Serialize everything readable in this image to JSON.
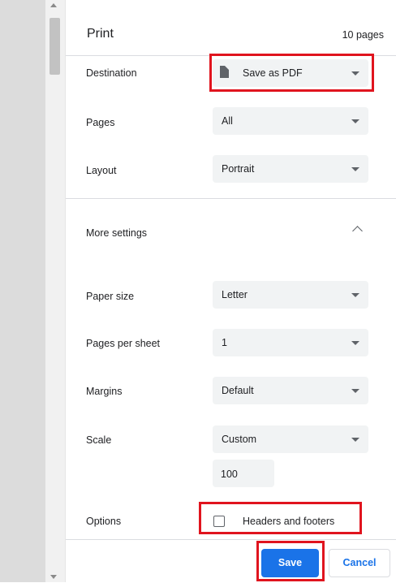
{
  "header": {
    "title": "Print",
    "page_count": "10 pages"
  },
  "settings": {
    "destination": {
      "label": "Destination",
      "value": "Save as PDF",
      "icon": "document-icon"
    },
    "pages": {
      "label": "Pages",
      "value": "All"
    },
    "layout": {
      "label": "Layout",
      "value": "Portrait"
    },
    "more_settings": {
      "label": "More settings",
      "icon": "chevron-up-icon"
    },
    "paper_size": {
      "label": "Paper size",
      "value": "Letter"
    },
    "pages_per_sheet": {
      "label": "Pages per sheet",
      "value": "1"
    },
    "margins": {
      "label": "Margins",
      "value": "Default"
    },
    "scale": {
      "label": "Scale",
      "value": "Custom",
      "custom_value": "100"
    },
    "options": {
      "label": "Options",
      "headers_and_footers": {
        "label": "Headers and footers",
        "checked": false
      }
    }
  },
  "footer": {
    "save_label": "Save",
    "cancel_label": "Cancel"
  },
  "colors": {
    "accent": "#1a73e8",
    "highlight": "#e0141e",
    "field_bg": "#f1f3f4"
  }
}
